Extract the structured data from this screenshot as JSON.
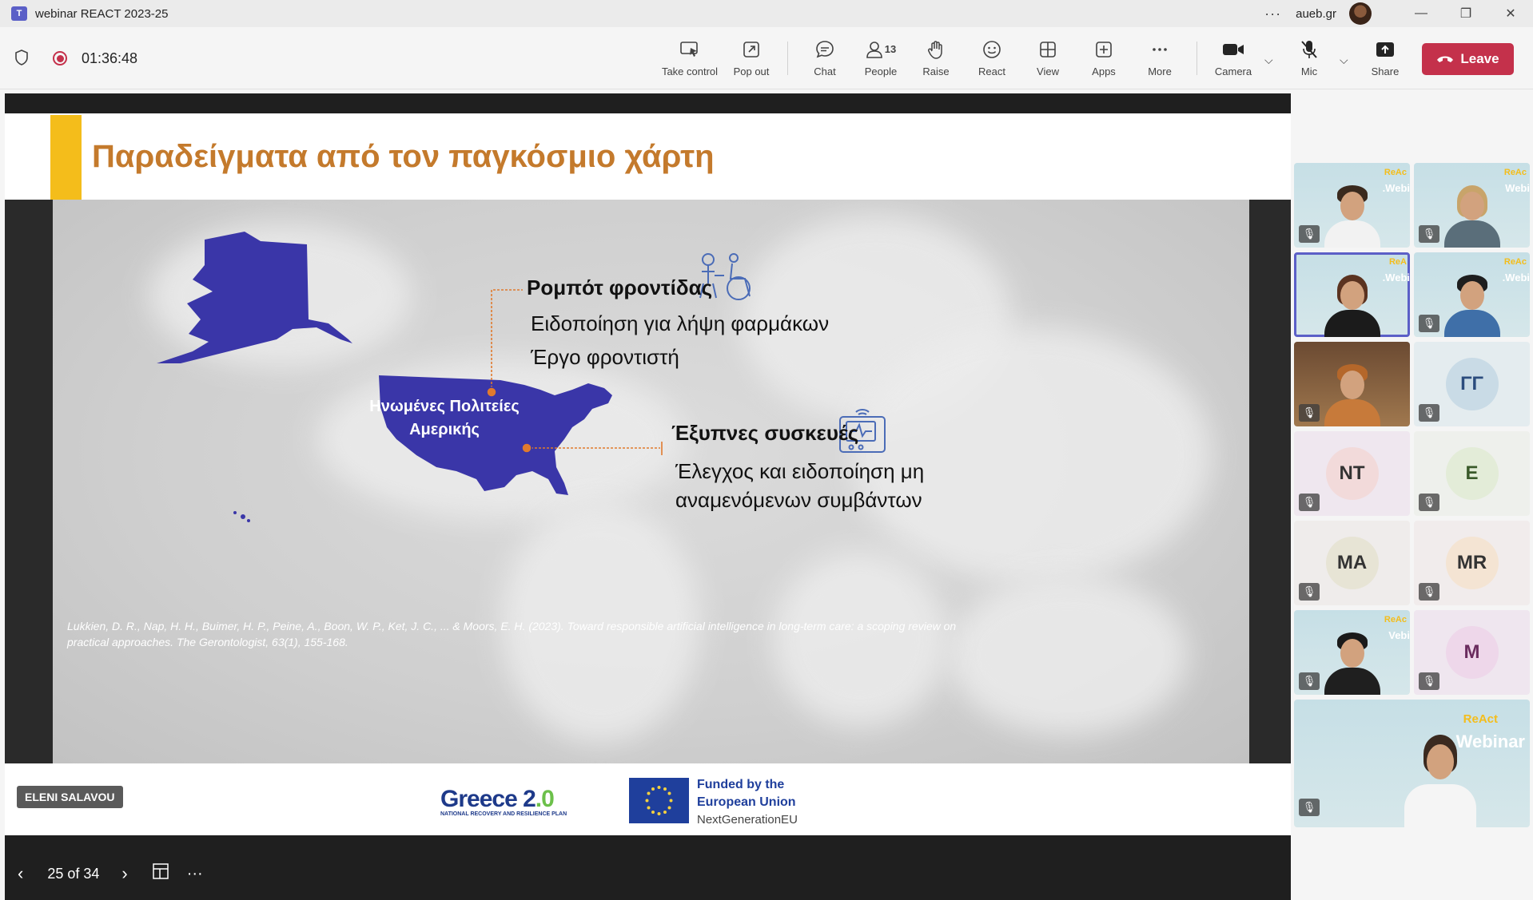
{
  "window": {
    "title": "webinar REACT 2023-25",
    "org": "aueb.gr",
    "more": "···",
    "minimize": "—",
    "restore": "❐",
    "close": "✕"
  },
  "toolbar": {
    "timer": "01:36:48",
    "take_control": "Take control",
    "pop_out": "Pop out",
    "chat": "Chat",
    "people": "People",
    "people_count": "13",
    "raise": "Raise",
    "react": "React",
    "view": "View",
    "apps": "Apps",
    "more": "More",
    "camera": "Camera",
    "mic": "Mic",
    "share": "Share",
    "leave": "Leave"
  },
  "slide": {
    "title": "Παραδείγματα από τον παγκόσμιο χάρτη",
    "usa_label_line1": "Ηνωμένες Πολιτείες",
    "usa_label_line2": "Αμερικής",
    "robot_title": "Ρομπότ φροντίδας",
    "robot_item1": "Ειδοποίηση για λήψη φαρμάκων",
    "robot_item2": "Έργο φροντιστή",
    "devices_title": "Έξυπνες συσκευές",
    "devices_item": "Έλεγχος και ειδοποίηση μη αναμενόμενων συμβάντων",
    "reference": "Lukkien, D. R., Nap, H. H., Buimer, H. P., Peine, A., Boon, W. P., Ket, J. C., ... & Moors, E. H. (2023). Toward responsible artificial intelligence in long-term care: a scoping review on practical approaches. The Gerontologist, 63(1), 155-168.",
    "presenter": "ELENI SALAVOU",
    "greece_logo_main": "Greece 2",
    "greece_logo_dot": ".0",
    "greece_logo_sub": "NATIONAL RECOVERY AND RESILIENCE PLAN",
    "eu_line1": "Funded by the",
    "eu_line2": "European Union",
    "eu_line3": "NextGenerationEU",
    "page": "25 of 34"
  },
  "participants": [
    {
      "kind": "video",
      "tag": "ReAc",
      "web": ".Webi"
    },
    {
      "kind": "video",
      "tag": "ReAc",
      "web": "Webi"
    },
    {
      "kind": "video",
      "tag": "ReA",
      "web": ".Webi"
    },
    {
      "kind": "video",
      "tag": "ReAc",
      "web": ".Webi"
    },
    {
      "kind": "video",
      "tag": "",
      "web": ""
    },
    {
      "kind": "initials",
      "initials": "ΓΓ"
    },
    {
      "kind": "initials",
      "initials": "NT"
    },
    {
      "kind": "initials",
      "initials": "E"
    },
    {
      "kind": "initials",
      "initials": "MA"
    },
    {
      "kind": "initials",
      "initials": "MR"
    },
    {
      "kind": "video",
      "tag": "ReAc",
      "web": "Vebi"
    },
    {
      "kind": "initials",
      "initials": "M"
    }
  ],
  "speaker_tile": {
    "tag": "ReAct",
    "web": ".Webinar"
  },
  "colors": {
    "accent": "#5b5fc7",
    "leave": "#c4314b",
    "title_orange": "#c47a2c",
    "usa_blue": "#3a36a8",
    "marker_orange": "#e07a2e",
    "yellow": "#f4bd1b"
  }
}
